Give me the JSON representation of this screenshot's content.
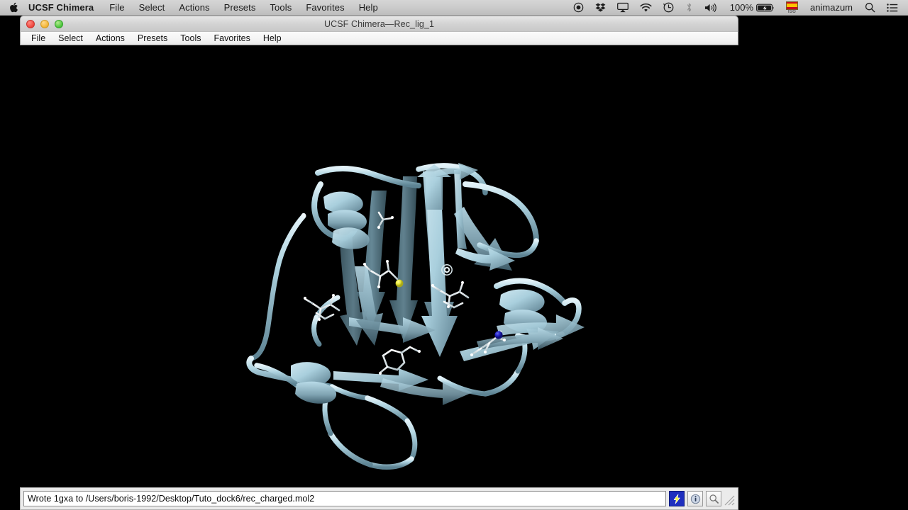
{
  "macos_menubar": {
    "apple_icon": "apple-logo-icon",
    "app_name": "UCSF Chimera",
    "menus": [
      "File",
      "Select",
      "Actions",
      "Presets",
      "Tools",
      "Favorites",
      "Help"
    ],
    "status_items": [
      {
        "name": "screen-recording-icon",
        "glyph": "◉"
      },
      {
        "name": "dropbox-icon",
        "glyph": "❖"
      },
      {
        "name": "airplay-icon",
        "glyph": "⬛"
      },
      {
        "name": "wifi-icon",
        "glyph": "◠"
      },
      {
        "name": "time-machine-icon",
        "glyph": "◴"
      },
      {
        "name": "bluetooth-icon",
        "glyph": "ᛦ"
      },
      {
        "name": "volume-icon",
        "glyph": "🔊"
      }
    ],
    "battery_percent": "100%",
    "battery_state": "charging",
    "input_source_flag": "Spain",
    "input_source_label": "ISO",
    "user_name": "animazum",
    "search_icon": "spotlight-search-icon",
    "notification_icon": "notification-center-icon"
  },
  "window": {
    "title": "UCSF Chimera—Rec_lig_1",
    "traffic_lights": {
      "close": "close",
      "minimize": "minimize",
      "zoom": "zoom"
    },
    "menus": [
      "File",
      "Select",
      "Actions",
      "Presets",
      "Tools",
      "Favorites",
      "Help"
    ]
  },
  "viewport": {
    "background_color": "#000000",
    "model_name": "1gxa",
    "representation": "ribbon cartoon with stick side chains",
    "ribbon_color": "#a9cfdd",
    "ribbon_shadow_color": "#4d6b78",
    "stick_carbon_color": "#e8f2f5",
    "sulfur_color": "#e8e83a",
    "nitrogen_color": "#2222c8",
    "pivot_marker": "rotation-center-marker"
  },
  "statusbar": {
    "message": "Wrote 1gxa to /Users/boris-1992/Desktop/Tuto_dock6/rec_charged.mol2",
    "buttons": [
      {
        "name": "lightning-bolt-button",
        "label": "⚡",
        "active": true
      },
      {
        "name": "info-button",
        "label": "i",
        "active": false
      },
      {
        "name": "magnifier-button",
        "label": "⚲",
        "active": false
      }
    ],
    "resize_grip": "resize-grip"
  }
}
